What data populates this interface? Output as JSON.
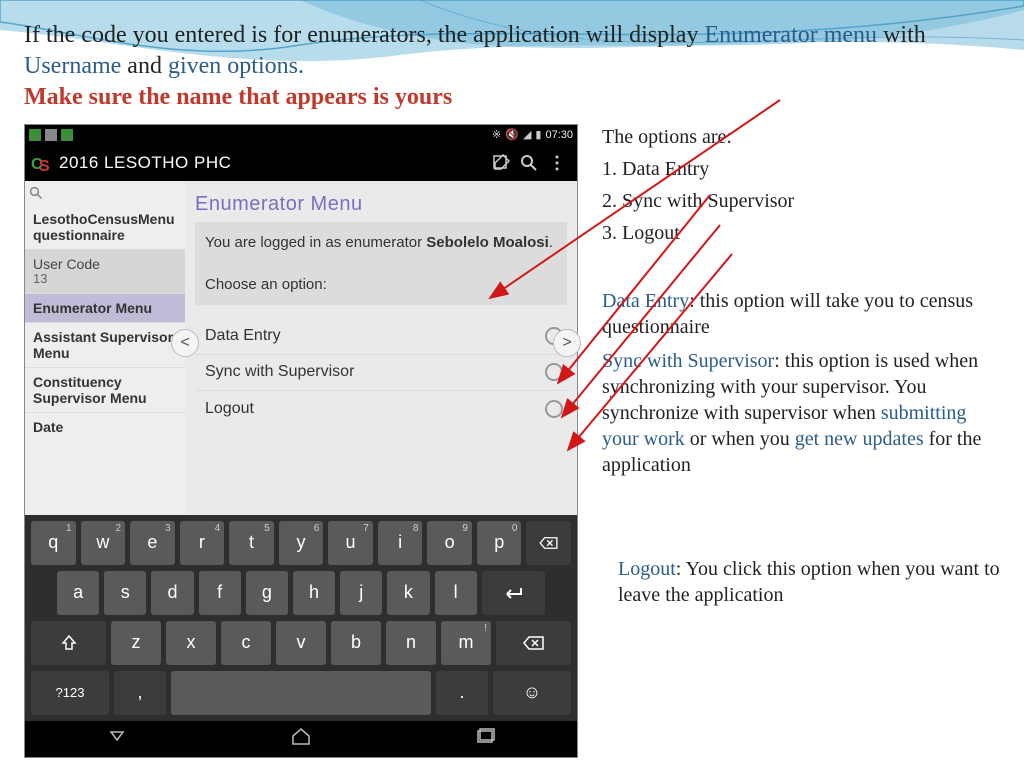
{
  "intro": {
    "t1": "If the code you entered is for enumerators, the application will display ",
    "enum_menu": "Enumerator menu",
    "t2": " with ",
    "username": "Username",
    "t3": " and ",
    "given": "given options.",
    "warn": "Make sure the name that appears is yours"
  },
  "phone": {
    "time": "07:30",
    "title": "2016 LESOTHO PHC",
    "sidebar": {
      "item0": "LesothoCensusMenu questionnaire",
      "item1_label": "User Code",
      "item1_value": "13",
      "item2": "Enumerator Menu",
      "item3": "Assistant Supervisor Menu",
      "item4": "Constituency Supervisor Menu",
      "item5": "Date"
    },
    "main": {
      "title": "Enumerator Menu",
      "logged1": "You are logged in as enumerator ",
      "name": "Sebolelo Moalosi",
      "dot": ".",
      "choose": "Choose an option:",
      "opt1": "Data Entry",
      "opt2": "Sync with Supervisor",
      "opt3": "Logout"
    },
    "keys_r1": [
      "q",
      "w",
      "e",
      "r",
      "t",
      "y",
      "u",
      "i",
      "o",
      "p"
    ],
    "keys_r1_hints": [
      "1",
      "2",
      "3",
      "4",
      "5",
      "6",
      "7",
      "8",
      "9",
      "0"
    ],
    "keys_r2": [
      "a",
      "s",
      "d",
      "f",
      "g",
      "h",
      "j",
      "k",
      "l"
    ],
    "keys_r3": [
      "z",
      "x",
      "c",
      "v",
      "b",
      "n",
      "m"
    ],
    "sym_key": "?123",
    "punct1": ",",
    "punct2": "."
  },
  "right": {
    "opt_intro": "The options are:",
    "o1": "1. Data Entry",
    "o2": "2. Sync with Supervisor",
    "o3": "3. Logout",
    "de_label": "Data Entry",
    "de_text": ": this option will take you to census questionnaire",
    "sync_label": "Sync with Supervisor",
    "sync_t1": ":  this option is used when synchronizing with your supervisor.  You synchronize with supervisor when ",
    "sync_submit": "submitting your work",
    "sync_t2": " or when you ",
    "sync_get": "get new updates",
    "sync_t3": " for the application",
    "lo_label": "Logout",
    "lo_text": ": You click this option when you want to leave the application"
  }
}
